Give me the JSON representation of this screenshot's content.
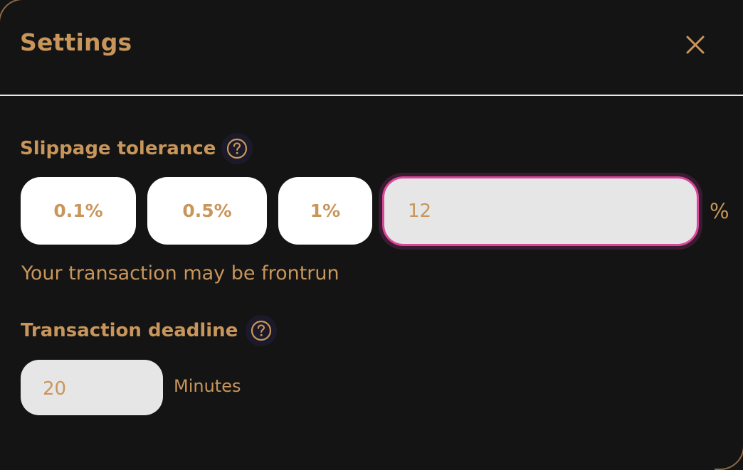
{
  "settings": {
    "title": "Settings",
    "close_icon": "close-icon"
  },
  "slippage": {
    "label": "Slippage tolerance",
    "help_icon": "question-circle-icon",
    "presets": [
      "0.1%",
      "0.5%",
      "1%"
    ],
    "custom_value": "12",
    "unit": "%",
    "warning": "Your transaction may be frontrun"
  },
  "deadline": {
    "label": "Transaction deadline",
    "help_icon": "question-circle-icon",
    "value": "20",
    "unit": "Minutes"
  },
  "colors": {
    "background": "#141414",
    "accent": "#c8965b",
    "focus_border": "#d9479a",
    "input_bg": "#e6e6e6",
    "preset_bg": "#ffffff"
  }
}
